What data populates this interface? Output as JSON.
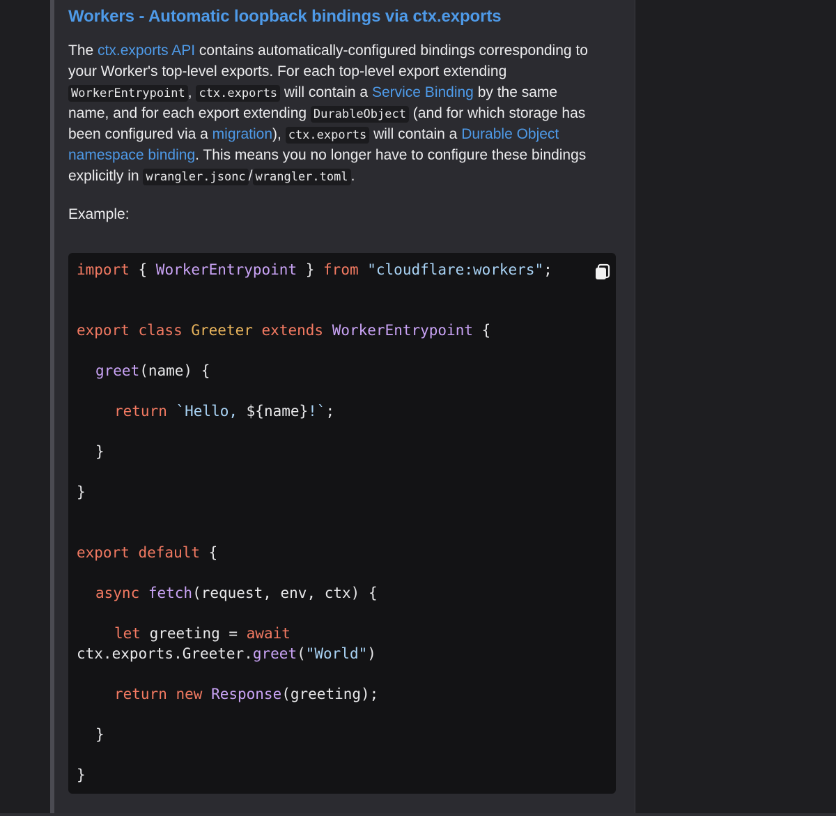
{
  "post": {
    "title": "Workers - Automatic loopback bindings via ctx.exports",
    "desc": {
      "l1_pre": "The ",
      "l1_link": "ctx.exports API",
      "l1_post": " contains automatically-configured bindings corresponding to",
      "l2": "your Worker's top-level exports. For each top-level export extending",
      "l3_code1": "WorkerEntrypoint",
      "l3_sep": ",",
      "l3_code2": "ctx.exports",
      "l3_mid": " will contain a ",
      "l3_link": "Service Binding",
      "l3_post": " by the same",
      "l4_pre": "name, and for each export extending ",
      "l4_code": "DurableObject",
      "l4_post": " (and for which storage has",
      "l5_pre": "been configured via a ",
      "l5_link": "migration",
      "l5_mid": "),",
      "l5_code": "ctx.exports",
      "l5_post": " will contain a ",
      "l5_link2": "Durable Object",
      "l6_link": "namespace binding",
      "l6_post": ". This means you no longer have to configure these bindings",
      "l7_pre": "explicitly in ",
      "l7_code1": "wrangler.jsonc",
      "l7_sep": "/",
      "l7_code2": "wrangler.toml",
      "l7_post": "."
    },
    "example_label": "Example:"
  },
  "code": {
    "copy_icon": "copy-icon",
    "t": {
      "import": "import",
      "brace_open": " { ",
      "WorkerEntrypoint": "WorkerEntrypoint",
      "brace_close": " } ",
      "from": "from",
      "module": " \"cloudflare:workers\"",
      "semi": ";",
      "export": "export",
      "class": " class ",
      "Greeter": "Greeter",
      "extends": " extends ",
      "ob": " {",
      "greet": "greet",
      "greet_args": "(name) {",
      "return": "return",
      "tpl1": " `Hello, ",
      "tpl2": "${name}",
      "tpl3": "!`",
      "cb": "}",
      "default": " default",
      "async": "async",
      "fetch": " fetch",
      "fetch_args": "(request, env, ctx) {",
      "let": "let",
      "greeting_eq": " greeting = ",
      "await": "await",
      "ctx_chain": "ctx.exports.Greeter.",
      "paren_open": "(",
      "world": "\"World\"",
      "paren_close": ")",
      "new": " new ",
      "Response": "Response",
      "resp_args": "(greeting);"
    }
  }
}
